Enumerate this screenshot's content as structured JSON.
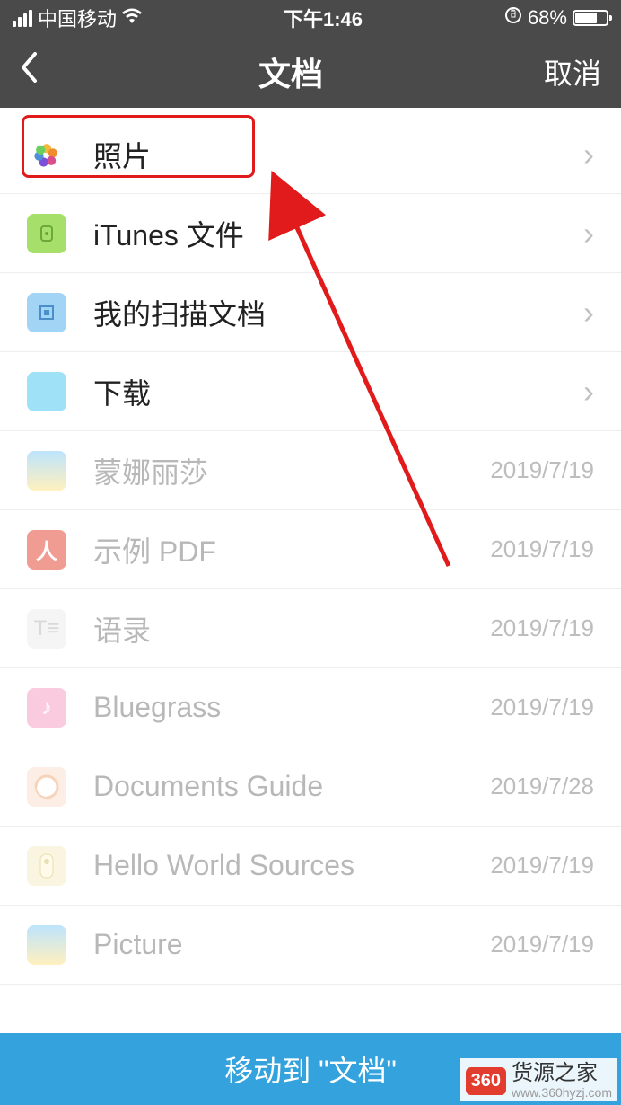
{
  "statusbar": {
    "carrier": "中国移动",
    "time": "下午1:46",
    "battery_pct": "68%"
  },
  "nav": {
    "title": "文档",
    "cancel": "取消"
  },
  "folders": [
    {
      "label": "照片",
      "icon": "photos"
    },
    {
      "label": "iTunes 文件",
      "icon": "folder-green"
    },
    {
      "label": "我的扫描文档",
      "icon": "folder-blue"
    },
    {
      "label": "下载",
      "icon": "folder-cyan"
    }
  ],
  "files": [
    {
      "label": "蒙娜丽莎",
      "date": "2019/7/19",
      "icon": "image"
    },
    {
      "label": "示例 PDF",
      "date": "2019/7/19",
      "icon": "pdf"
    },
    {
      "label": "语录",
      "date": "2019/7/19",
      "icon": "txt"
    },
    {
      "label": "Bluegrass",
      "date": "2019/7/19",
      "icon": "music"
    },
    {
      "label": "Documents Guide",
      "date": "2019/7/28",
      "icon": "guide"
    },
    {
      "label": "Hello World Sources",
      "date": "2019/7/19",
      "icon": "hw"
    },
    {
      "label": "Picture",
      "date": "2019/7/19",
      "icon": "image"
    }
  ],
  "bottom": {
    "action": "移动到 \"文档\""
  },
  "watermark": {
    "logo": "360",
    "name": "货源之家",
    "url": "www.360hyzj.com"
  },
  "highlight_index": 0
}
